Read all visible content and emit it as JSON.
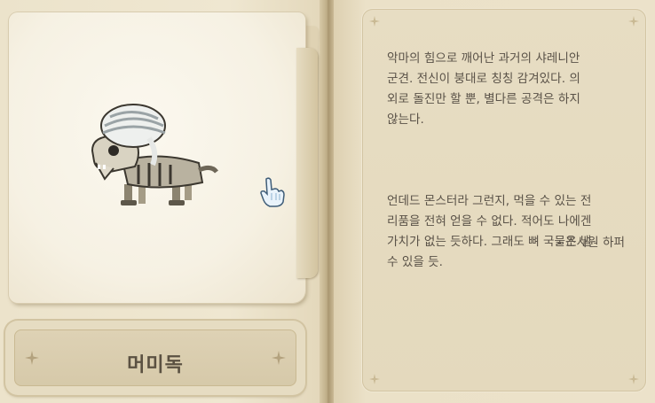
{
  "monster": {
    "name": "머미독",
    "icon": "mummy-dog-sprite"
  },
  "description": {
    "paragraphs": [
      "악마의 힘으로 깨어난 과거의 샤레니안\n군견. 전신이 붕대로 칭칭 감겨있다. 의\n외로 돌진만 할 뿐, 별다른 공격은 하지\n않는다.",
      "언데드 몬스터라 그런지, 먹을 수 있는 전\n리품을 전혀 얻을 수 없다. 적어도 나에겐\n가치가 없는 듯하다. 그래도 뼈 국물은 낼\n수 있을 듯."
    ],
    "signature": "- 조사원 하퍼"
  },
  "decor": {
    "star_icon": "four-point-star-icon",
    "cursor_icon": "glove-pointer-cursor-icon"
  }
}
